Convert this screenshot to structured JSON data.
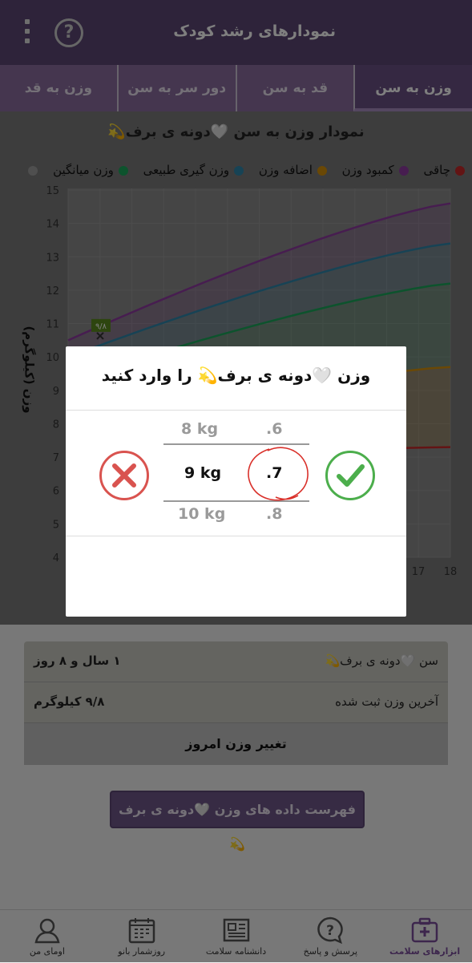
{
  "header": {
    "title": "نمودارهای رشد کودک",
    "help_icon": "question-circle-icon",
    "menu_icon": "overflow-menu-icon"
  },
  "tabs": [
    {
      "label": "وزن به سن",
      "active": true
    },
    {
      "label": "قد به سن",
      "active": false
    },
    {
      "label": "دور سر به سن",
      "active": false
    },
    {
      "label": "وزن به قد",
      "active": false
    }
  ],
  "chart": {
    "title": "نمودار وزن به سن 🤍دونه ی برف💫",
    "legend": [
      {
        "label": "چاقی",
        "color": "#c62828"
      },
      {
        "label": "کمبود وزن",
        "color": "#8e3aa0"
      },
      {
        "label": "اضافه وزن",
        "color": "#d4900a"
      },
      {
        "label": "وزن گیری طبیعی",
        "color": "#2e86ab"
      },
      {
        "label": "وزن میانگین",
        "color": "#1aa65a"
      },
      {
        "label": "",
        "color": "#9e9e9e"
      }
    ],
    "ylabel": "وزن (کیلوگرم)",
    "marker_label": "۹/۸"
  },
  "chart_data": {
    "type": "line",
    "ylabel": "وزن (کیلوگرم)",
    "ylim": [
      4,
      15
    ],
    "yticks": [
      "4",
      "5",
      "6",
      "7",
      "8",
      "9",
      "10",
      "11",
      "12",
      "13",
      "14",
      "15"
    ],
    "xticks": [
      "17",
      "18"
    ],
    "series": [
      {
        "name": "کمبود وزن",
        "color": "#8e3aa0",
        "values_at_x_start_end": [
          10.5,
          14.6
        ]
      },
      {
        "name": "وزن گیری طبیعی",
        "color": "#2e86ab",
        "values_at_x_start_end": [
          10.0,
          13.4
        ]
      },
      {
        "name": "وزن میانگین",
        "color": "#1aa65a",
        "values_at_x_start_end": [
          9.3,
          12.2
        ]
      },
      {
        "name": "اضافه وزن",
        "color": "#d4900a",
        "values_at_x_start_end": [
          8.0,
          9.7
        ]
      },
      {
        "name": "چاقی",
        "color": "#c62828",
        "values_at_x_start_end": [
          6.9,
          7.3
        ]
      }
    ],
    "point": {
      "label": "۹/۸",
      "value": 10.8
    }
  },
  "dialog": {
    "title": "وزن 🤍دونه ی برف💫 را وارد کنید",
    "kg_values": [
      "8 kg",
      "9 kg",
      "10 kg"
    ],
    "decimal_values": [
      ".6",
      ".7",
      ".8"
    ],
    "cancel_icon": "close-circle-icon",
    "confirm_icon": "check-circle-icon"
  },
  "info": {
    "age_label": "سن 🤍دونه ی برف💫",
    "age_value": "۱ سال و ۸ روز",
    "last_weight_label": "آخرین وزن ثبت شده",
    "last_weight_value": "۹/۸ کیلوگرم",
    "change_weight_button": "تغییر وزن امروز"
  },
  "list_button": "فهرست داده های وزن 🤍دونه ی برف💫",
  "bottom_nav": [
    {
      "label": "ابزارهای سلامت",
      "icon": "medical-kit-icon",
      "active": true
    },
    {
      "label": "پرسش و پاسخ",
      "icon": "question-bubble-icon",
      "active": false
    },
    {
      "label": "دانشنامه سلامت",
      "icon": "newspaper-icon",
      "active": false
    },
    {
      "label": "روزشمار بانو",
      "icon": "calendar-icon",
      "active": false
    },
    {
      "label": "اومای من",
      "icon": "profile-icon",
      "active": false
    }
  ]
}
